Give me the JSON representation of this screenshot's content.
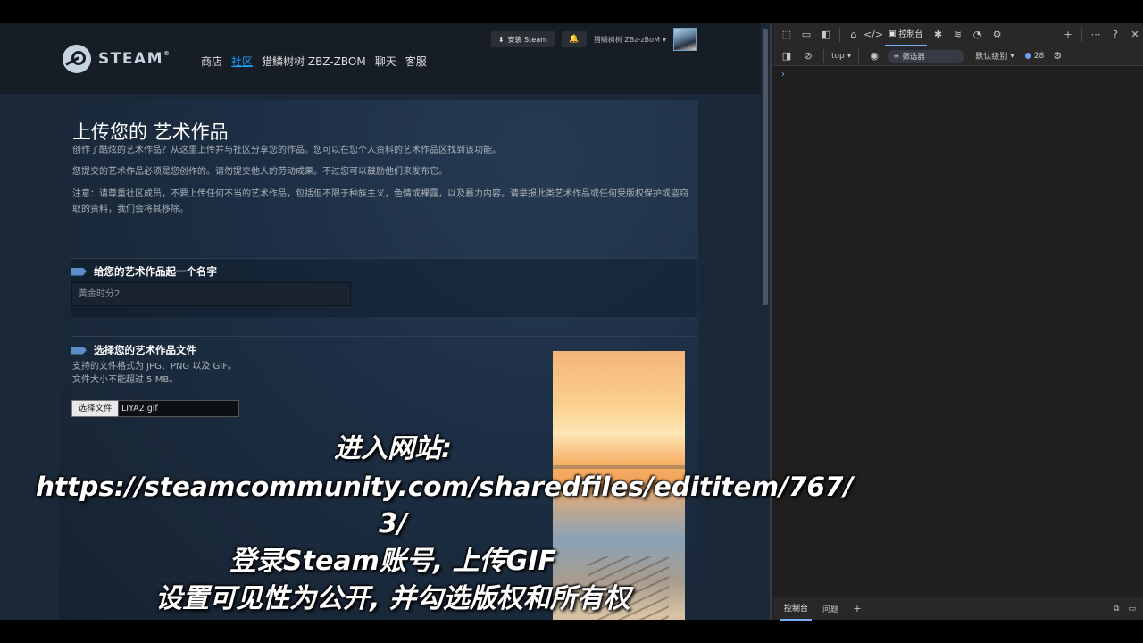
{
  "steam": {
    "logo_text": "STEAM",
    "nav": [
      "商店",
      "社区",
      "猎鳞树树 ZBZ-ZBOM",
      "聊天",
      "客服"
    ],
    "install_label": "安装 Steam",
    "username": "猎鳞树树 ZBz-zBoM",
    "page_title": "上传您的 艺术作品",
    "intro": "创作了酷炫的艺术作品？从这里上传并与社区分享您的作品。您可以在您个人资料的艺术作品区找到该功能。",
    "rule1": "您提交的艺术作品必须是您创作的。请勿提交他人的劳动成果。不过您可以鼓励他们来发布它。",
    "rule2": "注意：请尊重社区成员，不要上传任何不当的艺术作品，包括但不限于种族主义，色情或裸露，以及暴力内容。请举报此类艺术作品或任何受版权保护或盗窃取的资料，我们会将其移除。",
    "name_section": "给您的艺术作品起一个名字",
    "name_value": "黄金时分2",
    "file_section": "选择您的艺术作品文件",
    "file_formats": "支持的文件格式为 JPG、PNG 以及 GIF。",
    "file_size": "文件大小不能超过 5 MB。",
    "choose_file": "选择文件",
    "file_name": "LIYA2.gif"
  },
  "devtools": {
    "console_tab": "控制台",
    "context": "top",
    "filter_placeholder": "筛选器",
    "levels": "默认级别",
    "issues_count": "28",
    "drawer_tabs": [
      "控制台",
      "问题"
    ]
  },
  "caption": {
    "line1": "进入网站:",
    "line2": "https://steamcommunity.com/sharedfiles/edititem/767/",
    "line3": "3/",
    "line4": "登录Steam账号, 上传GIF",
    "line5": "设置可见性为公开, 并勾选版权和所有权"
  }
}
